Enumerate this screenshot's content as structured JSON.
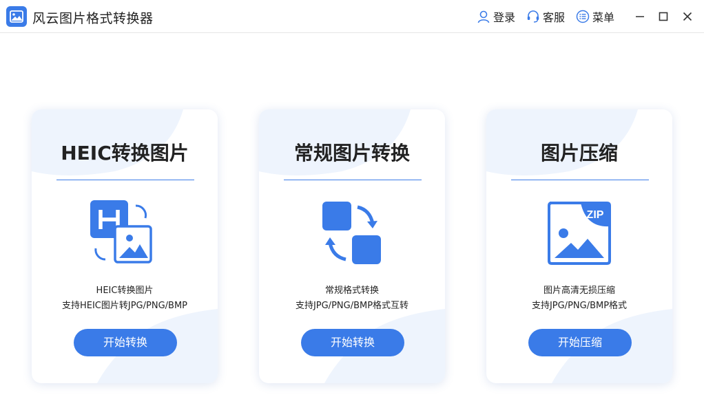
{
  "app": {
    "title": "风云图片格式转换器",
    "icon": "image-app-icon"
  },
  "header": {
    "login_label": "登录",
    "service_label": "客服",
    "menu_label": "菜单"
  },
  "window_controls": [
    "minimize-icon",
    "maximize-icon",
    "close-icon"
  ],
  "colors": {
    "accent": "#3a7be8",
    "card_decoration": "#eef4fd",
    "title_text": "#222222"
  },
  "cards": [
    {
      "title": "HEIC转换图片",
      "icon": "heic-to-image-icon",
      "desc_line1": "HEIC转换图片",
      "desc_line2": "支持HEIC图片转JPG/PNG/BMP",
      "button_label": "开始转换"
    },
    {
      "title": "常规图片转换",
      "icon": "format-convert-icon",
      "desc_line1": "常规格式转换",
      "desc_line2": "支持JPG/PNG/BMP格式互转",
      "button_label": "开始转换"
    },
    {
      "title": "图片压缩",
      "icon": "zip-compress-icon",
      "icon_badge": "ZIP",
      "desc_line1": "图片高清无损压缩",
      "desc_line2": "支持JPG/PNG/BMP格式",
      "button_label": "开始压缩"
    }
  ]
}
